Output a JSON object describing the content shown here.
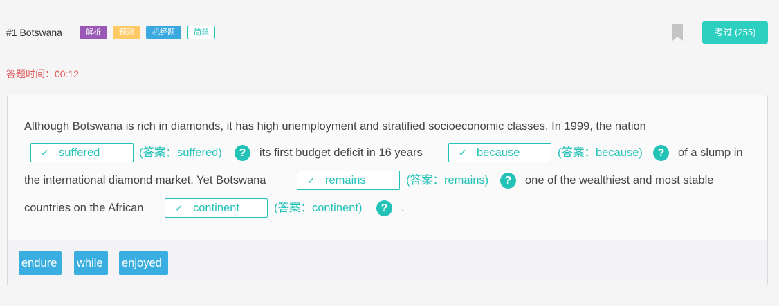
{
  "header": {
    "title": "#1 Botswana",
    "tags": [
      "解析",
      "预测",
      "机经题",
      "简单"
    ],
    "exam_button": "考过 (255)",
    "bookmark_icon": "bookmark-icon"
  },
  "timer": {
    "label": "答题时间：00:12"
  },
  "passage": {
    "line1": "Although Botswana is rich in diamonds, it has high unemployment and stratified socioeconomic classes. In 1999, the nation",
    "blank1": {
      "value": "suffered",
      "answer": "(答案：suffered)"
    },
    "text2": "its first budget deficit in 16 years",
    "blank2": {
      "value": "because",
      "answer": "(答案：because)"
    },
    "text3": "of a slump in",
    "text4": "the international diamond market. Yet Botswana",
    "blank3": {
      "value": "remains",
      "answer": "(答案：remains)"
    },
    "text5": "one of the wealthiest and most stable",
    "text6": "countries on the African",
    "blank4": {
      "value": "continent",
      "answer": "(答案：continent)"
    },
    "text7": "."
  },
  "word_bank": [
    "endure",
    "while",
    "enjoyed"
  ],
  "colors": {
    "accent": "#23c2b7",
    "timer": "#e05a5a",
    "chip": "#3aaee0"
  }
}
